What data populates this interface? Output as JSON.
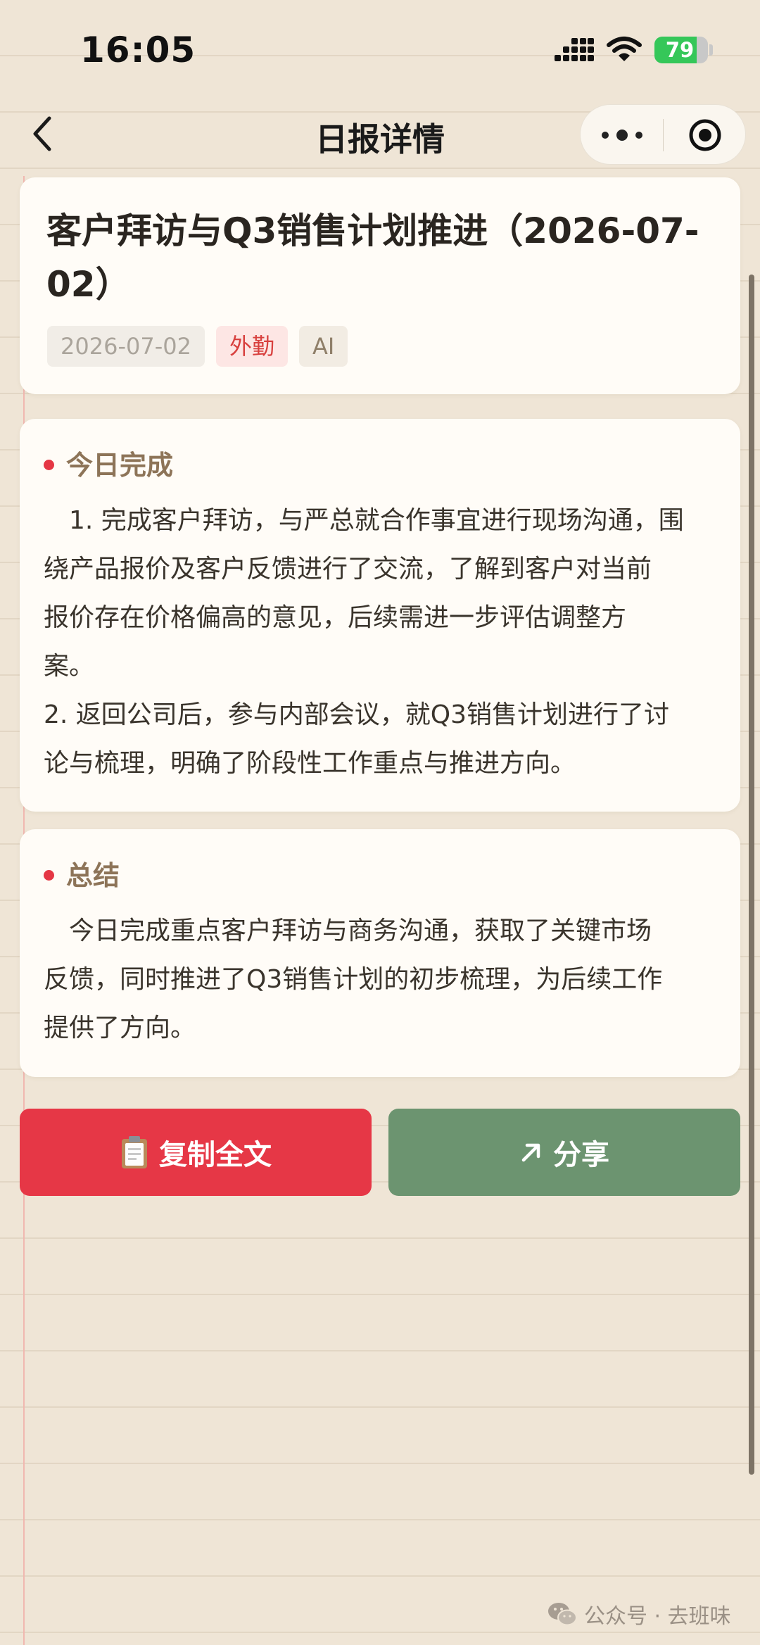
{
  "status_bar": {
    "time": "16:05",
    "battery_level": "79",
    "battery_fraction": 0.79,
    "icons": [
      "signal-icon",
      "wifi-icon",
      "battery-icon"
    ]
  },
  "nav": {
    "title": "日报详情",
    "icons": [
      "chevron-left-icon",
      "more-dots-icon",
      "target-icon"
    ]
  },
  "report": {
    "title_line1": "客户拜访与Q3销售计划推进（2026-07-",
    "title_line2": "02）",
    "tags": {
      "date": "2026-07-02",
      "type": "外勤",
      "ai": "AI"
    }
  },
  "sections": {
    "done": {
      "title": "今日完成",
      "lines": [
        "　1. 完成客户拜访，与严总就合作事宜进行现场沟通，围",
        "绕产品报价及客户反馈进行了交流，了解到客户对当前",
        "报价存在价格偏高的意见，后续需进一步评估调整方",
        "案。",
        "2. 返回公司后，参与内部会议，就Q3销售计划进行了讨",
        "论与梳理，明确了阶段性工作重点与推进方向。"
      ]
    },
    "summary": {
      "title": "总结",
      "lines": [
        "　今日完成重点客户拜访与商务沟通，获取了关键市场",
        "反馈，同时推进了Q3销售计划的初步梳理，为后续工作",
        "提供了方向。"
      ]
    }
  },
  "actions": {
    "copy_label": "复制全文",
    "share_label": "分享"
  },
  "watermark": {
    "text": "公众号 · 去班味"
  },
  "colors": {
    "accent_red": "#e63746",
    "share_green": "#6c9470",
    "section_title": "#8d7458",
    "background": "#efe5d6"
  }
}
